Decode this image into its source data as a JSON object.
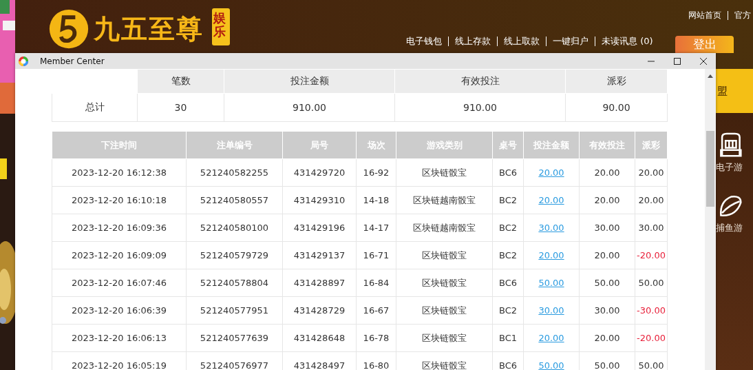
{
  "site": {
    "logo_text": "九五至尊",
    "logo_badge": "娱乐",
    "top_links": [
      "网站首页",
      "官方"
    ],
    "nav_links": [
      "电子钱包",
      "线上存款",
      "线上取款",
      "一键归户",
      "未读讯息 (0)"
    ],
    "logout": "登出",
    "side_tab": "盟",
    "side_items": [
      {
        "kind": "slot",
        "label": "电子游"
      },
      {
        "kind": "fish",
        "label": "捕鱼游"
      }
    ]
  },
  "window": {
    "title": "Member Center"
  },
  "summary": {
    "columns": [
      "笔数",
      "投注金额",
      "有效投注",
      "派彩"
    ],
    "label": "总计",
    "values": [
      "30",
      "910.00",
      "910.00",
      "90.00"
    ]
  },
  "table": {
    "columns": [
      "下注时间",
      "注单编号",
      "局号",
      "场次",
      "游戏类别",
      "桌号",
      "投注金额",
      "有效投注",
      "派彩"
    ],
    "rows": [
      {
        "time": "2023-12-20 16:12:38",
        "order": "521240582255",
        "round": "431429720",
        "session": "16-92",
        "game": "区块链骰宝",
        "table": "BC6",
        "bet": "20.00",
        "valid": "20.00",
        "payout": "20.00",
        "negative": false
      },
      {
        "time": "2023-12-20 16:10:18",
        "order": "521240580557",
        "round": "431429310",
        "session": "14-18",
        "game": "区块链越南骰宝",
        "table": "BC2",
        "bet": "20.00",
        "valid": "20.00",
        "payout": "20.00",
        "negative": false
      },
      {
        "time": "2023-12-20 16:09:36",
        "order": "521240580100",
        "round": "431429196",
        "session": "14-17",
        "game": "区块链越南骰宝",
        "table": "BC2",
        "bet": "30.00",
        "valid": "30.00",
        "payout": "30.00",
        "negative": false
      },
      {
        "time": "2023-12-20 16:09:09",
        "order": "521240579729",
        "round": "431429137",
        "session": "16-71",
        "game": "区块链骰宝",
        "table": "BC2",
        "bet": "20.00",
        "valid": "20.00",
        "payout": "-20.00",
        "negative": true
      },
      {
        "time": "2023-12-20 16:07:46",
        "order": "521240578804",
        "round": "431428897",
        "session": "16-84",
        "game": "区块链骰宝",
        "table": "BC6",
        "bet": "50.00",
        "valid": "50.00",
        "payout": "50.00",
        "negative": false
      },
      {
        "time": "2023-12-20 16:06:39",
        "order": "521240577951",
        "round": "431428729",
        "session": "16-67",
        "game": "区块链骰宝",
        "table": "BC2",
        "bet": "30.00",
        "valid": "30.00",
        "payout": "-30.00",
        "negative": true
      },
      {
        "time": "2023-12-20 16:06:13",
        "order": "521240577639",
        "round": "431428648",
        "session": "16-78",
        "game": "区块链骰宝",
        "table": "BC1",
        "bet": "20.00",
        "valid": "20.00",
        "payout": "-20.00",
        "negative": true
      },
      {
        "time": "2023-12-20 16:05:19",
        "order": "521240576977",
        "round": "431428497",
        "session": "16-80",
        "game": "区块链骰宝",
        "table": "BC6",
        "bet": "50.00",
        "valid": "50.00",
        "payout": "50.00",
        "negative": false
      }
    ]
  }
}
